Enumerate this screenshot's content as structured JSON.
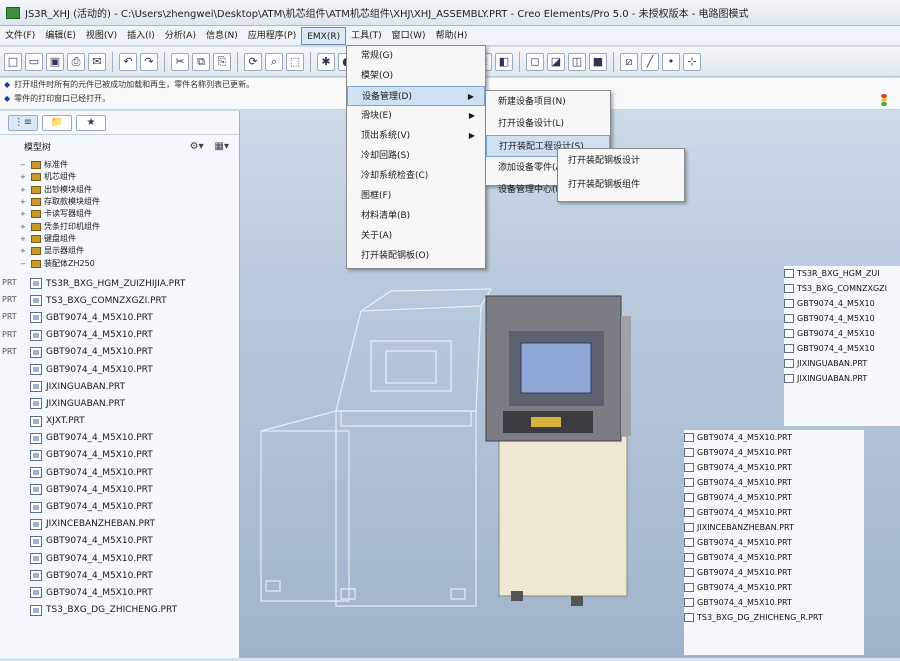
{
  "window": {
    "title": "JS3R_XHJ (活动的) - C:\\Users\\zhengwei\\Desktop\\ATM\\机芯组件\\ATM机芯组件\\XHJ\\XHJ_ASSEMBLY.PRT - Creo Elements/Pro 5.0 - 未授权版本 - 电路图模式"
  },
  "menubar": {
    "items": [
      "文件(F)",
      "编辑(E)",
      "视图(V)",
      "插入(I)",
      "分析(A)",
      "信息(N)",
      "应用程序(P)",
      "EMX(R)",
      "工具(T)",
      "窗口(W)",
      "帮助(H)"
    ],
    "active_index": 7
  },
  "toolbar": {
    "icons": [
      "new-icon",
      "open-icon",
      "save-icon",
      "print-icon",
      "email-icon",
      "sep",
      "undo-icon",
      "redo-icon",
      "sep",
      "cut-icon",
      "copy-icon",
      "paste-icon",
      "sep",
      "regenerate-icon",
      "find-icon",
      "select-icon",
      "sep",
      "spin-center-icon",
      "orient-icon",
      "zoom-in-icon",
      "zoom-out-icon",
      "refit-icon",
      "reorient-icon",
      "view-manager-icon",
      "sep",
      "layers-icon",
      "display-icon",
      "sep",
      "wireframe-icon",
      "hidden-line-icon",
      "no-hidden-icon",
      "shading-icon",
      "sep",
      "datum-plane-icon",
      "datum-axis-icon",
      "datum-point-icon",
      "coord-sys-icon"
    ]
  },
  "prompts": [
    "打开组件时所有的元件已被成功加载和再生，零件名称列表已更新。",
    "零件的打印窗口已经打开。"
  ],
  "navigator": {
    "tabs": [
      "model-tree-icon",
      "folder-icon",
      "favorites-icon"
    ],
    "header": "模型树",
    "tree_items": [
      {
        "label": "标准件",
        "expanded": true
      },
      {
        "label": "机芯组件",
        "expanded": false
      },
      {
        "label": "出钞模块组件",
        "expanded": false
      },
      {
        "label": "存取款模块组件",
        "expanded": false
      },
      {
        "label": "卡读写器组件",
        "expanded": false
      },
      {
        "label": "凭条打印机组件",
        "expanded": false
      },
      {
        "label": "键盘组件",
        "expanded": false
      },
      {
        "label": "显示器组件",
        "expanded": false
      },
      {
        "label": "装配体ZH250",
        "expanded": true
      }
    ],
    "parts": [
      "TS3R_BXG_HGM_ZUIZHIJIA.PRT",
      "TS3_BXG_COMNZXGZI.PRT",
      "GBT9074_4_M5X10.PRT",
      "GBT9074_4_M5X10.PRT",
      "GBT9074_4_M5X10.PRT",
      "GBT9074_4_M5X10.PRT",
      "JIXINGUABAN.PRT",
      "JIXINGUABAN.PRT",
      "XJXT.PRT",
      "GBT9074_4_M5X10.PRT",
      "GBT9074_4_M5X10.PRT",
      "GBT9074_4_M5X10.PRT",
      "GBT9074_4_M5X10.PRT",
      "GBT9074_4_M5X10.PRT",
      "JIXINCEBANZHEBAN.PRT",
      "GBT9074_4_M5X10.PRT",
      "GBT9074_4_M5X10.PRT",
      "GBT9074_4_M5X10.PRT",
      "GBT9074_4_M5X10.PRT",
      "TS3_BXG_DG_ZHICHENG.PRT"
    ],
    "side_labels": [
      "PRT",
      "PRT",
      "PRT",
      "PRT",
      "PRT"
    ]
  },
  "emx_menu": {
    "items": [
      {
        "label": "常规(G)",
        "submenu": false
      },
      {
        "label": "模架(O)",
        "submenu": false
      },
      {
        "label": "设备管理(D)",
        "submenu": true,
        "hover": true
      },
      {
        "label": "滑块(E)",
        "submenu": true
      },
      {
        "label": "顶出系统(V)",
        "submenu": true
      },
      {
        "label": "冷却回路(S)",
        "submenu": false
      },
      {
        "label": "冷却系统检查(C)",
        "submenu": false
      },
      {
        "label": "图框(F)",
        "submenu": false
      },
      {
        "label": "材料清单(B)",
        "submenu": false
      },
      {
        "label": "关于(A)",
        "submenu": false
      },
      {
        "label": "打开装配钢板(O)",
        "submenu": false
      }
    ]
  },
  "device_submenu": {
    "items": [
      {
        "label": "新建设备项目(N)",
        "hover": false
      },
      {
        "label": "打开设备设计(L)",
        "hover": false
      },
      {
        "label": "打开装配工程设计(S)",
        "hover": true
      },
      {
        "label": "添加设备零件(A)",
        "hover": false
      },
      {
        "label": "设备管理中心(M)",
        "hover": false
      }
    ]
  },
  "project_submenu": {
    "items": [
      "打开装配钢板设计",
      "打开装配钢板组件"
    ]
  },
  "floating_lists": {
    "right_top": [
      "TS3R_BXG_HGM_ZUI",
      "TS3_BXG_COMNZXGZI",
      "GBT9074_4_M5X10",
      "GBT9074_4_M5X10",
      "GBT9074_4_M5X10",
      "GBT9074_4_M5X10",
      "JIXINGUABAN.PRT",
      "JIXINGUABAN.PRT"
    ],
    "right_bottom": [
      "GBT9074_4_M5X10.PRT",
      "GBT9074_4_M5X10.PRT",
      "GBT9074_4_M5X10.PRT",
      "GBT9074_4_M5X10.PRT",
      "GBT9074_4_M5X10.PRT",
      "GBT9074_4_M5X10.PRT",
      "JIXINCEBANZHEBAN.PRT",
      "GBT9074_4_M5X10.PRT",
      "GBT9074_4_M5X10.PRT",
      "GBT9074_4_M5X10.PRT",
      "GBT9074_4_M5X10.PRT",
      "GBT9074_4_M5X10.PRT",
      "TS3_BXG_DG_ZHICHENG_R.PRT"
    ]
  },
  "colors": {
    "accent": "#7fa4cc",
    "hover_bg": "#cfe0f3",
    "graphics_bg": "#b8c9dc"
  }
}
